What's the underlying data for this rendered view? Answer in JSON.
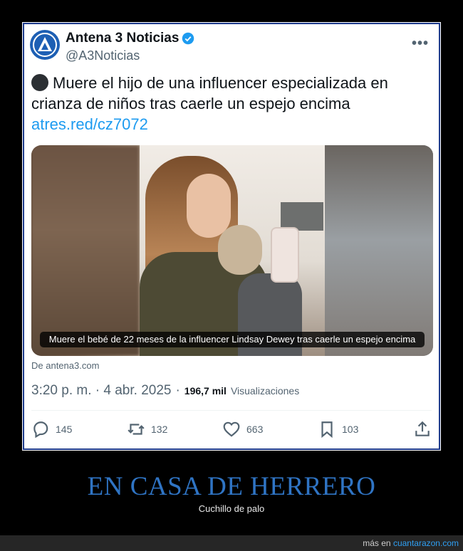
{
  "tweet": {
    "display_name": "Antena 3 Noticias",
    "handle": "@A3Noticias",
    "text": "Muere el hijo de una influencer especializada en crianza de niños tras caerle un espejo encima",
    "link": "atres.red/cz7072",
    "media_caption": "Muere el bebé de 22 meses de la influencer Lindsay Dewey tras caerle un espejo encima",
    "source": "De antena3.com",
    "timestamp": "3:20 p. m. · 4 abr. 2025",
    "separator": "·",
    "views_count": "196,7 mil",
    "views_label": "Visualizaciones",
    "replies": "145",
    "retweets": "132",
    "likes": "663",
    "bookmarks": "103",
    "accent_color": "#1d9bf0"
  },
  "page": {
    "headline": "EN CASA DE HERRERO",
    "subhead": "Cuchillo de palo",
    "footer_prefix": "más en",
    "footer_link": "cuantarazon.com"
  }
}
